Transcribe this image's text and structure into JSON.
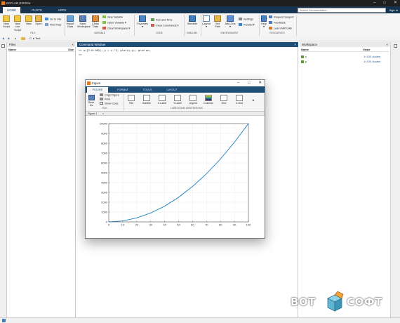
{
  "app": {
    "title": "MATLAB R2023a",
    "tabs": [
      "HOME",
      "PLOTS",
      "APPS"
    ],
    "active_tab": "HOME",
    "search_placeholder": "Search Documentation",
    "sign_in": "Sign In"
  },
  "ribbon": {
    "new_script": "New Script",
    "new_live_script": "New Live Script",
    "new": "New",
    "open": "Open",
    "go_to_file": "Go to File",
    "find_files": "Find Files",
    "import_data": "Import Data",
    "save_workspace": "Save Workspace",
    "clean_data": "Clean Data",
    "new_variable": "New Variable",
    "open_variable": "Open Variable",
    "clear_workspace": "Clear Workspace",
    "favorites": "Favorites",
    "run_and_time": "Run and Time",
    "clear_commands": "Clear Commands",
    "simulink": "Simulink",
    "layout": "Layout",
    "set_path": "Set Path",
    "add_ons": "Add-Ons",
    "settings": "Settings",
    "parallel": "Parallel",
    "help": "Help",
    "request_support": "Request Support",
    "feedback": "Feedback",
    "learn_matlab": "Learn MATLAB",
    "group_file": "FILE",
    "group_variable": "VARIABLE",
    "group_code": "CODE",
    "group_simulink": "SIMULINK",
    "group_environment": "ENVIRONMENT",
    "group_resources": "RESOURCES"
  },
  "address": {
    "path": "C:  ▸  Test"
  },
  "files_panel": {
    "title": "Files",
    "col_name": "Name",
    "col_size": "Size"
  },
  "command_window": {
    "title": "Command Window",
    "lines": [
      ">> x=[1:0:100]; y = x.^2; plot(x,y); grid on;",
      ">>"
    ]
  },
  "workspace": {
    "title": "Workspace",
    "col_name": "Name",
    "col_value": "Value",
    "vars": [
      {
        "name": "x",
        "value": "1×100 double"
      },
      {
        "name": "y",
        "value": "1×100 double"
      }
    ]
  },
  "figure": {
    "title": "Figure",
    "tabs": [
      "FIGURE",
      "FORMAT",
      "TOOLS",
      "LAYOUT"
    ],
    "save_as": "Save As",
    "copy_figure": "Copy Figure",
    "print": "Print",
    "show_code": "Show Code",
    "file_group": "FILE",
    "buttons": [
      "Title",
      "Subtitle",
      "X-Label",
      "Y-Label",
      "Legend",
      "Colorbar",
      "Grid",
      "X-Grid"
    ],
    "labels_group": "LABELS AND ANNOTATIONS",
    "doc_tab": "Figure 1"
  },
  "chart_data": {
    "type": "line",
    "x": [
      0,
      10,
      20,
      30,
      40,
      50,
      60,
      70,
      80,
      90,
      100
    ],
    "series": [
      {
        "values": [
          0,
          100,
          400,
          900,
          1600,
          2500,
          3600,
          4900,
          6400,
          8100,
          10000
        ],
        "color": "#0072bd"
      }
    ],
    "xlim": [
      0,
      100
    ],
    "ylim": [
      0,
      10000
    ],
    "xticks": [
      0,
      10,
      20,
      30,
      40,
      50,
      60,
      70,
      80,
      90,
      100
    ],
    "yticks": [
      0,
      1000,
      2000,
      3000,
      4000,
      5000,
      6000,
      7000,
      8000,
      9000,
      10000
    ],
    "grid": true,
    "title": "",
    "xlabel": "",
    "ylabel": ""
  },
  "watermark": {
    "left": "BOT",
    "right": "COФТ"
  }
}
